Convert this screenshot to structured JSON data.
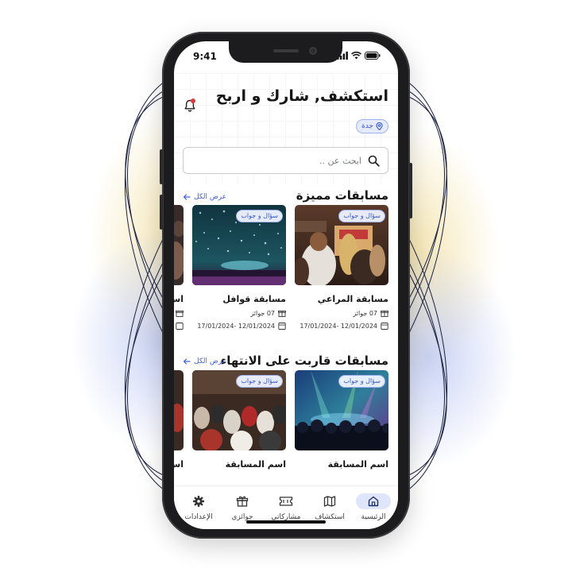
{
  "status_bar": {
    "time": "9:41"
  },
  "header": {
    "title": "استكشف, شارك و اربح",
    "location": "جدة"
  },
  "search": {
    "placeholder": "ابحث عن .."
  },
  "featured": {
    "title": "مسابقات مميزة",
    "see_all": "عرض الكل",
    "cards": [
      {
        "tag": "سؤال و جواب",
        "name": "مسابقة المراعي",
        "prizes": "07 جوائز",
        "dates": "12/01/2024 -17/01/2024"
      },
      {
        "tag": "سؤال و جواب",
        "name": "مسابقة قوافل",
        "prizes": "07 جوائز",
        "dates": "12/01/2024 -17/01/2024"
      },
      {
        "tag": "",
        "name": "اس",
        "prizes": "",
        "dates": ""
      }
    ]
  },
  "ending_soon": {
    "title": "مسابقات قاربت على الانتهاء",
    "see_all": "عرض الكل",
    "cards": [
      {
        "tag": "سؤال و جواب",
        "name": "اسم المسابقة"
      },
      {
        "tag": "سؤال و جواب",
        "name": "اسم المسابقة"
      },
      {
        "tag": "",
        "name": "اس"
      }
    ]
  },
  "bottom_nav": {
    "items": [
      {
        "label": "الرئيسية",
        "icon": "home-icon",
        "active": true
      },
      {
        "label": "استكشاف",
        "icon": "map-icon",
        "active": false
      },
      {
        "label": "مشاركاتي",
        "icon": "ticket-icon",
        "active": false
      },
      {
        "label": "جوائزي",
        "icon": "gift-icon",
        "active": false
      },
      {
        "label": "الإعدادات",
        "icon": "gear-icon",
        "active": false
      }
    ]
  },
  "colors": {
    "accent": "#3d5fd3",
    "chip_bg": "#e6ebfb",
    "notification_dot": "#e03b3b",
    "phone_frame": "#1c1c1e"
  }
}
